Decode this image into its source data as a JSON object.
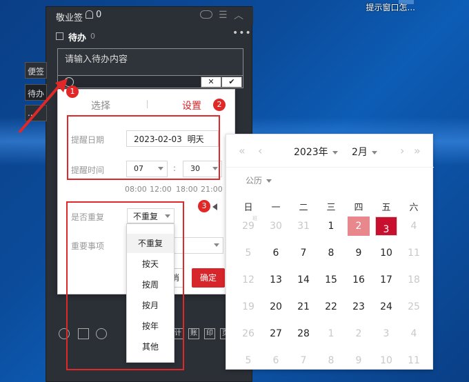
{
  "desktop": {
    "shortcut_label": "提示窗口怎..."
  },
  "widget": {
    "app_title": "敬业签",
    "bell_count": "0",
    "todo_label": "待办",
    "todo_count": "0",
    "more_label": "•••",
    "input_placeholder": "请输入待办内容",
    "cancel_label": "✕",
    "confirm_label": "✔",
    "side_tabs": [
      "便签",
      "待办",
      "..."
    ],
    "bottom_icons": [
      "clock-icon",
      "calendar-icon",
      "search-icon",
      "ji",
      "zhang",
      "yin",
      "ye"
    ],
    "bottom_icon_labels": [
      "",
      "",
      "",
      "计",
      "账",
      "印",
      "页"
    ]
  },
  "popup": {
    "tab_select": "选择",
    "tab_settings": "设置",
    "remind_date_label": "提醒日期",
    "remind_date_value": "2023-02-03",
    "remind_date_suffix": "明天",
    "remind_time_label": "提醒时间",
    "hour_value": "07",
    "time_sep": ":",
    "minute_value": "30",
    "quick_times": [
      "08:00",
      "12:00",
      "18:00",
      "21:00"
    ],
    "repeat_label": "是否重复",
    "repeat_value": "不重复",
    "important_label": "重要事项",
    "cancel_stub": "消",
    "confirm_label": "确定"
  },
  "repeat_options": [
    "不重复",
    "按天",
    "按周",
    "按月",
    "按年",
    "其他"
  ],
  "calendar": {
    "year_label": "2023年",
    "month_label": "2月",
    "calendar_type": "公历",
    "weekdays": [
      "日",
      "一",
      "二",
      "三",
      "四",
      "五",
      "六"
    ],
    "weeks": [
      [
        "29",
        "30",
        "31",
        "1",
        "2",
        "3",
        "4"
      ],
      [
        "5",
        "6",
        "7",
        "8",
        "9",
        "10",
        "11"
      ],
      [
        "12",
        "13",
        "14",
        "15",
        "16",
        "17",
        "18"
      ],
      [
        "19",
        "20",
        "21",
        "22",
        "23",
        "24",
        "25"
      ],
      [
        "26",
        "27",
        "28",
        "1",
        "2",
        "3",
        "4"
      ],
      [
        "5",
        "6",
        "7",
        "8",
        "9",
        "10",
        "11"
      ]
    ],
    "small_mark": "班"
  },
  "annotations": {
    "n1": "1",
    "n2": "2",
    "n3": "3"
  },
  "colors": {
    "accent": "#d6262b",
    "today": "#e8888c",
    "selected": "#c8102e",
    "annotation": "#e02828"
  }
}
